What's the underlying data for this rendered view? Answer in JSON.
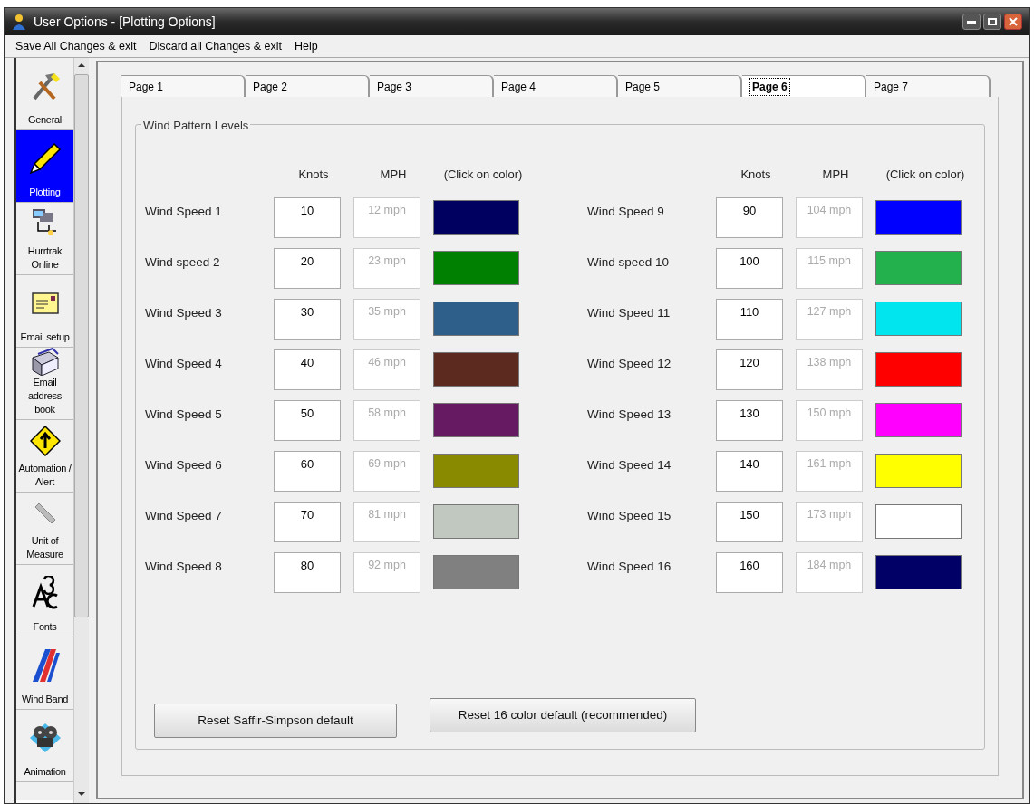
{
  "window": {
    "title": "User Options - [Plotting Options]"
  },
  "menu": [
    "Save All Changes & exit",
    "Discard all Changes & exit",
    "Help"
  ],
  "sidebar": {
    "items": [
      {
        "label": "General",
        "selected": false
      },
      {
        "label": "Plotting",
        "selected": true
      },
      {
        "label": "Hurrtrak Online",
        "selected": false
      },
      {
        "label": "Email setup",
        "selected": false
      },
      {
        "label": "Email address book",
        "selected": false
      },
      {
        "label": "Automation / Alert",
        "selected": false
      },
      {
        "label": "Unit of Measure",
        "selected": false
      },
      {
        "label": "Fonts",
        "selected": false
      },
      {
        "label": "Wind Band",
        "selected": false
      },
      {
        "label": "Animation",
        "selected": false
      }
    ]
  },
  "tabs": [
    {
      "label": "Page 1",
      "selected": false
    },
    {
      "label": "Page 2",
      "selected": false
    },
    {
      "label": "Page 3",
      "selected": false
    },
    {
      "label": "Page 4",
      "selected": false
    },
    {
      "label": "Page 5",
      "selected": false
    },
    {
      "label": "Page 6",
      "selected": true
    },
    {
      "label": "Page 7",
      "selected": false
    }
  ],
  "group": {
    "title": "Wind Pattern Levels",
    "columns": [
      {
        "headers": [
          "Knots",
          "MPH",
          "(Click on color)"
        ],
        "rows": [
          {
            "label": "Wind Speed 1",
            "knots": "10",
            "mph": "12 mph",
            "color": "#000060"
          },
          {
            "label": "Wind speed 2",
            "knots": "20",
            "mph": "23 mph",
            "color": "#008000"
          },
          {
            "label": "Wind Speed 3",
            "knots": "30",
            "mph": "35 mph",
            "color": "#2e5f8a"
          },
          {
            "label": "Wind Speed 4",
            "knots": "40",
            "mph": "46 mph",
            "color": "#5c2a1e"
          },
          {
            "label": "Wind Speed 5",
            "knots": "50",
            "mph": "58 mph",
            "color": "#651a62"
          },
          {
            "label": "Wind Speed 6",
            "knots": "60",
            "mph": "69 mph",
            "color": "#8a8a00"
          },
          {
            "label": "Wind Speed 7",
            "knots": "70",
            "mph": "81 mph",
            "color": "#c0c8c0"
          },
          {
            "label": "Wind Speed 8",
            "knots": "80",
            "mph": "92 mph",
            "color": "#808080"
          }
        ]
      },
      {
        "headers": [
          "Knots",
          "MPH",
          "(Click on color)"
        ],
        "rows": [
          {
            "label": "Wind Speed 9",
            "knots": "90",
            "mph": "104 mph",
            "color": "#0000ff"
          },
          {
            "label": "Wind speed 10",
            "knots": "100",
            "mph": "115 mph",
            "color": "#22b14c"
          },
          {
            "label": "Wind Speed 11",
            "knots": "110",
            "mph": "127 mph",
            "color": "#00e5ee"
          },
          {
            "label": "Wind Speed 12",
            "knots": "120",
            "mph": "138 mph",
            "color": "#ff0000"
          },
          {
            "label": "Wind Speed 13",
            "knots": "130",
            "mph": "150 mph",
            "color": "#ff00ff"
          },
          {
            "label": "Wind Speed 14",
            "knots": "140",
            "mph": "161 mph",
            "color": "#ffff00"
          },
          {
            "label": "Wind Speed 15",
            "knots": "150",
            "mph": "173 mph",
            "color": "#ffffff"
          },
          {
            "label": "Wind Speed 16",
            "knots": "160",
            "mph": "184 mph",
            "color": "#000066"
          }
        ]
      }
    ],
    "buttons": [
      "Reset Saffir-Simpson default",
      "Reset 16 color default (recommended)"
    ]
  }
}
